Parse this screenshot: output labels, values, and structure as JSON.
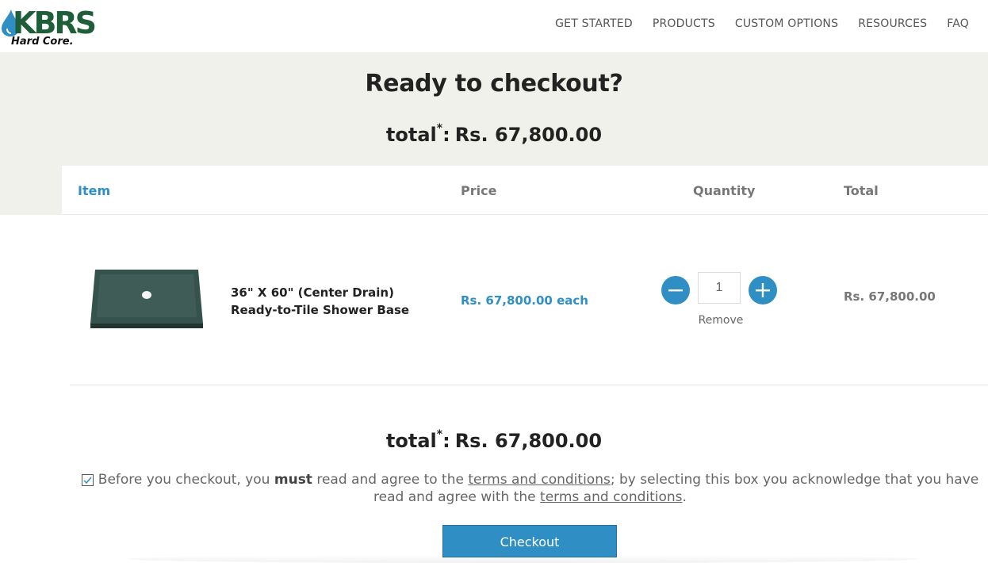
{
  "header": {
    "logo_text": "KBRS",
    "logo_subtext": "Hard Core.",
    "nav": [
      "GET STARTED",
      "PRODUCTS",
      "CUSTOM OPTIONS",
      "RESOURCES",
      "FAQ"
    ]
  },
  "checkout": {
    "title": "Ready to checkout?",
    "total_label": "total",
    "total_mark": "*",
    "total_colon": ":",
    "total_value": "Rs. 67,800.00"
  },
  "table": {
    "headers": {
      "item": "Item",
      "price": "Price",
      "quantity": "Quantity",
      "total": "Total"
    },
    "rows": [
      {
        "name": "36\" X 60\" (Center Drain) Ready-to-Tile Shower Base",
        "price": "Rs. 67,800.00 each",
        "quantity": "1",
        "remove": "Remove",
        "total": "Rs. 67,800.00"
      }
    ]
  },
  "terms": {
    "before": "Before you checkout, you",
    "must": "must",
    "middle": "read and agree to the",
    "link1": "terms and conditions",
    "after": "; by selecting this box you acknowledge that you have read and agree with the",
    "link2": "terms and conditions",
    "end": ".",
    "checked": true
  },
  "checkout_button": "Checkout",
  "colors": {
    "accent": "#2f8ec4",
    "band": "#f1f1eb",
    "logo_green": "#1e5f3a"
  }
}
